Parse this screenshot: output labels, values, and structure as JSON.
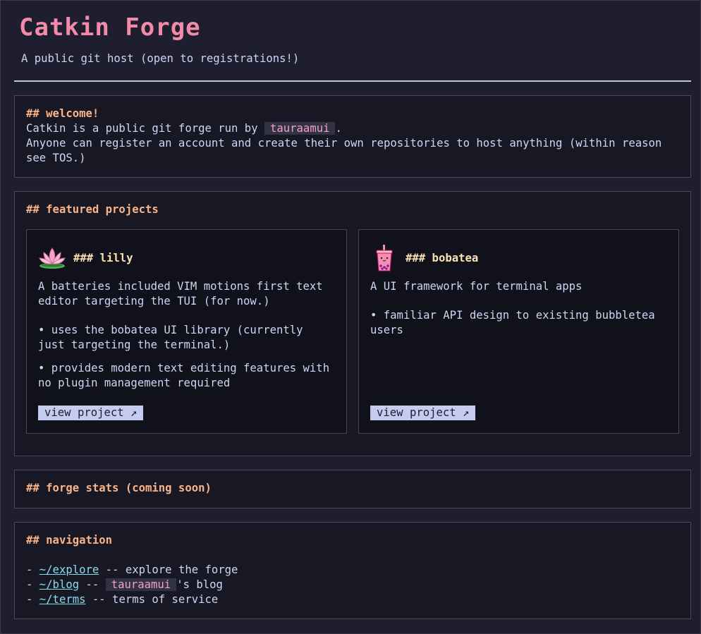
{
  "header": {
    "title": "Catkin Forge",
    "subtitle": "A public git host (open to registrations!)"
  },
  "welcome": {
    "heading": "## welcome!",
    "line1_prefix": "Catkin is a public git forge run by",
    "owner": "tauraamui",
    "line1_suffix": ".",
    "line2": "Anyone can register an account and create their own repositories to host anything (within reason",
    "line3": "see TOS.)"
  },
  "featured": {
    "heading": "## featured projects",
    "projects": [
      {
        "title": "### lilly",
        "icon": "lotus-icon",
        "description": "A batteries included VIM motions first text editor targeting the TUI (for now.)",
        "bullets": [
          "• uses the bobatea UI library (currently just targeting the terminal.)",
          "• provides modern text editing features with no plugin management required"
        ],
        "button": "view project ↗"
      },
      {
        "title": "### bobatea",
        "icon": "boba-tea-icon",
        "description": "A UI framework for terminal apps",
        "bullets": [
          "• familiar API design to existing bubbletea users"
        ],
        "button": "view project ↗"
      }
    ]
  },
  "stats": {
    "heading": "## forge stats (coming soon)"
  },
  "navigation": {
    "heading": "## navigation",
    "items": [
      {
        "prefix": "- ",
        "link": "~/explore",
        "rest": " -- explore the forge"
      },
      {
        "prefix": "- ",
        "link": "~/blog",
        "mid": " -- ",
        "owner": "tauraamui",
        "rest": "'s blog"
      },
      {
        "prefix": "- ",
        "link": "~/terms",
        "rest": " -- terms of service"
      }
    ]
  },
  "colors": {
    "background": "#1e1e2e",
    "title": "#f38ba8",
    "heading": "#fab387",
    "card_title": "#f9e2af",
    "link": "#89dceb",
    "button_bg": "#c5ccf0"
  }
}
